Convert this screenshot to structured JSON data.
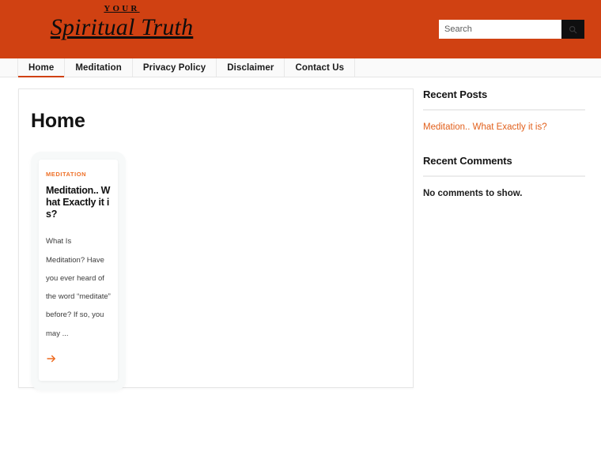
{
  "header": {
    "brand_pre": "YOUR",
    "brand_main": "Spiritual Truth",
    "brand_color": "#d04112",
    "search": {
      "value": "",
      "placeholder": "Search",
      "button_icon": "search-icon",
      "button_color": "#0f0f10"
    }
  },
  "nav": {
    "items": [
      {
        "label": "Home",
        "active": true
      },
      {
        "label": "Meditation",
        "active": false
      },
      {
        "label": "Privacy Policy",
        "active": false
      },
      {
        "label": "Disclaimer",
        "active": false
      },
      {
        "label": "Contact Us",
        "active": false
      }
    ],
    "accent_color": "#d04112"
  },
  "main": {
    "page_title": "Home",
    "posts": [
      {
        "category": "MEDITATION",
        "category_color": "#ef7027",
        "title": "Meditation.. What Exactly it is?",
        "excerpt": "What Is Meditation? Have you ever heard of the word “meditate” before? If so, you may ...",
        "read_more_icon": "arrow-right-icon",
        "read_more_color": "#ed6a1f"
      }
    ]
  },
  "sidebar": {
    "widgets": [
      {
        "title": "Recent Posts",
        "links": [
          "Meditation.. What Exactly it is?"
        ],
        "text": ""
      },
      {
        "title": "Recent Comments",
        "links": [],
        "text": "No comments to show."
      }
    ],
    "link_color": "#e2601c"
  }
}
